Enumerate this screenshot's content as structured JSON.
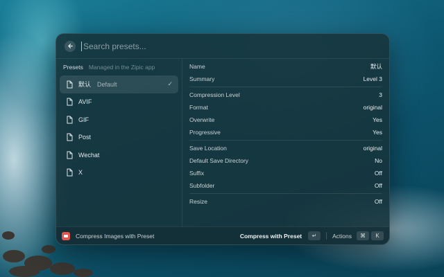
{
  "search": {
    "placeholder": "Search presets..."
  },
  "presets_panel": {
    "title": "Presets",
    "subtitle": "Managed in the Zipic app",
    "items": [
      {
        "label": "默认",
        "alt": "Default",
        "selected": true
      },
      {
        "label": "AVIF"
      },
      {
        "label": "GIF"
      },
      {
        "label": "Post"
      },
      {
        "label": "Wechat"
      },
      {
        "label": "X"
      }
    ]
  },
  "details": {
    "name": {
      "label": "Name",
      "value": "默认"
    },
    "summary": {
      "label": "Summary",
      "value": "Level 3"
    },
    "compression_level": {
      "label": "Compression Level",
      "value": "3"
    },
    "format": {
      "label": "Format",
      "value": "original"
    },
    "overwrite": {
      "label": "Overwrite",
      "value": "Yes"
    },
    "progressive": {
      "label": "Progressive",
      "value": "Yes"
    },
    "save_location": {
      "label": "Save Location",
      "value": "original"
    },
    "default_save_directory": {
      "label": "Default Save Directory",
      "value": "No"
    },
    "suffix": {
      "label": "Suffix",
      "value": "Off"
    },
    "subfolder": {
      "label": "Subfolder",
      "value": "Off"
    },
    "resize": {
      "label": "Resize",
      "value": "Off"
    }
  },
  "footer": {
    "command": "Compress Images with Preset",
    "primary_action": "Compress with Preset",
    "primary_key": "↵",
    "actions_label": "Actions",
    "actions_keys": [
      "⌘",
      "K"
    ]
  },
  "colors": {
    "app_icon": "#e2564f",
    "window_bg": "#16343c"
  }
}
